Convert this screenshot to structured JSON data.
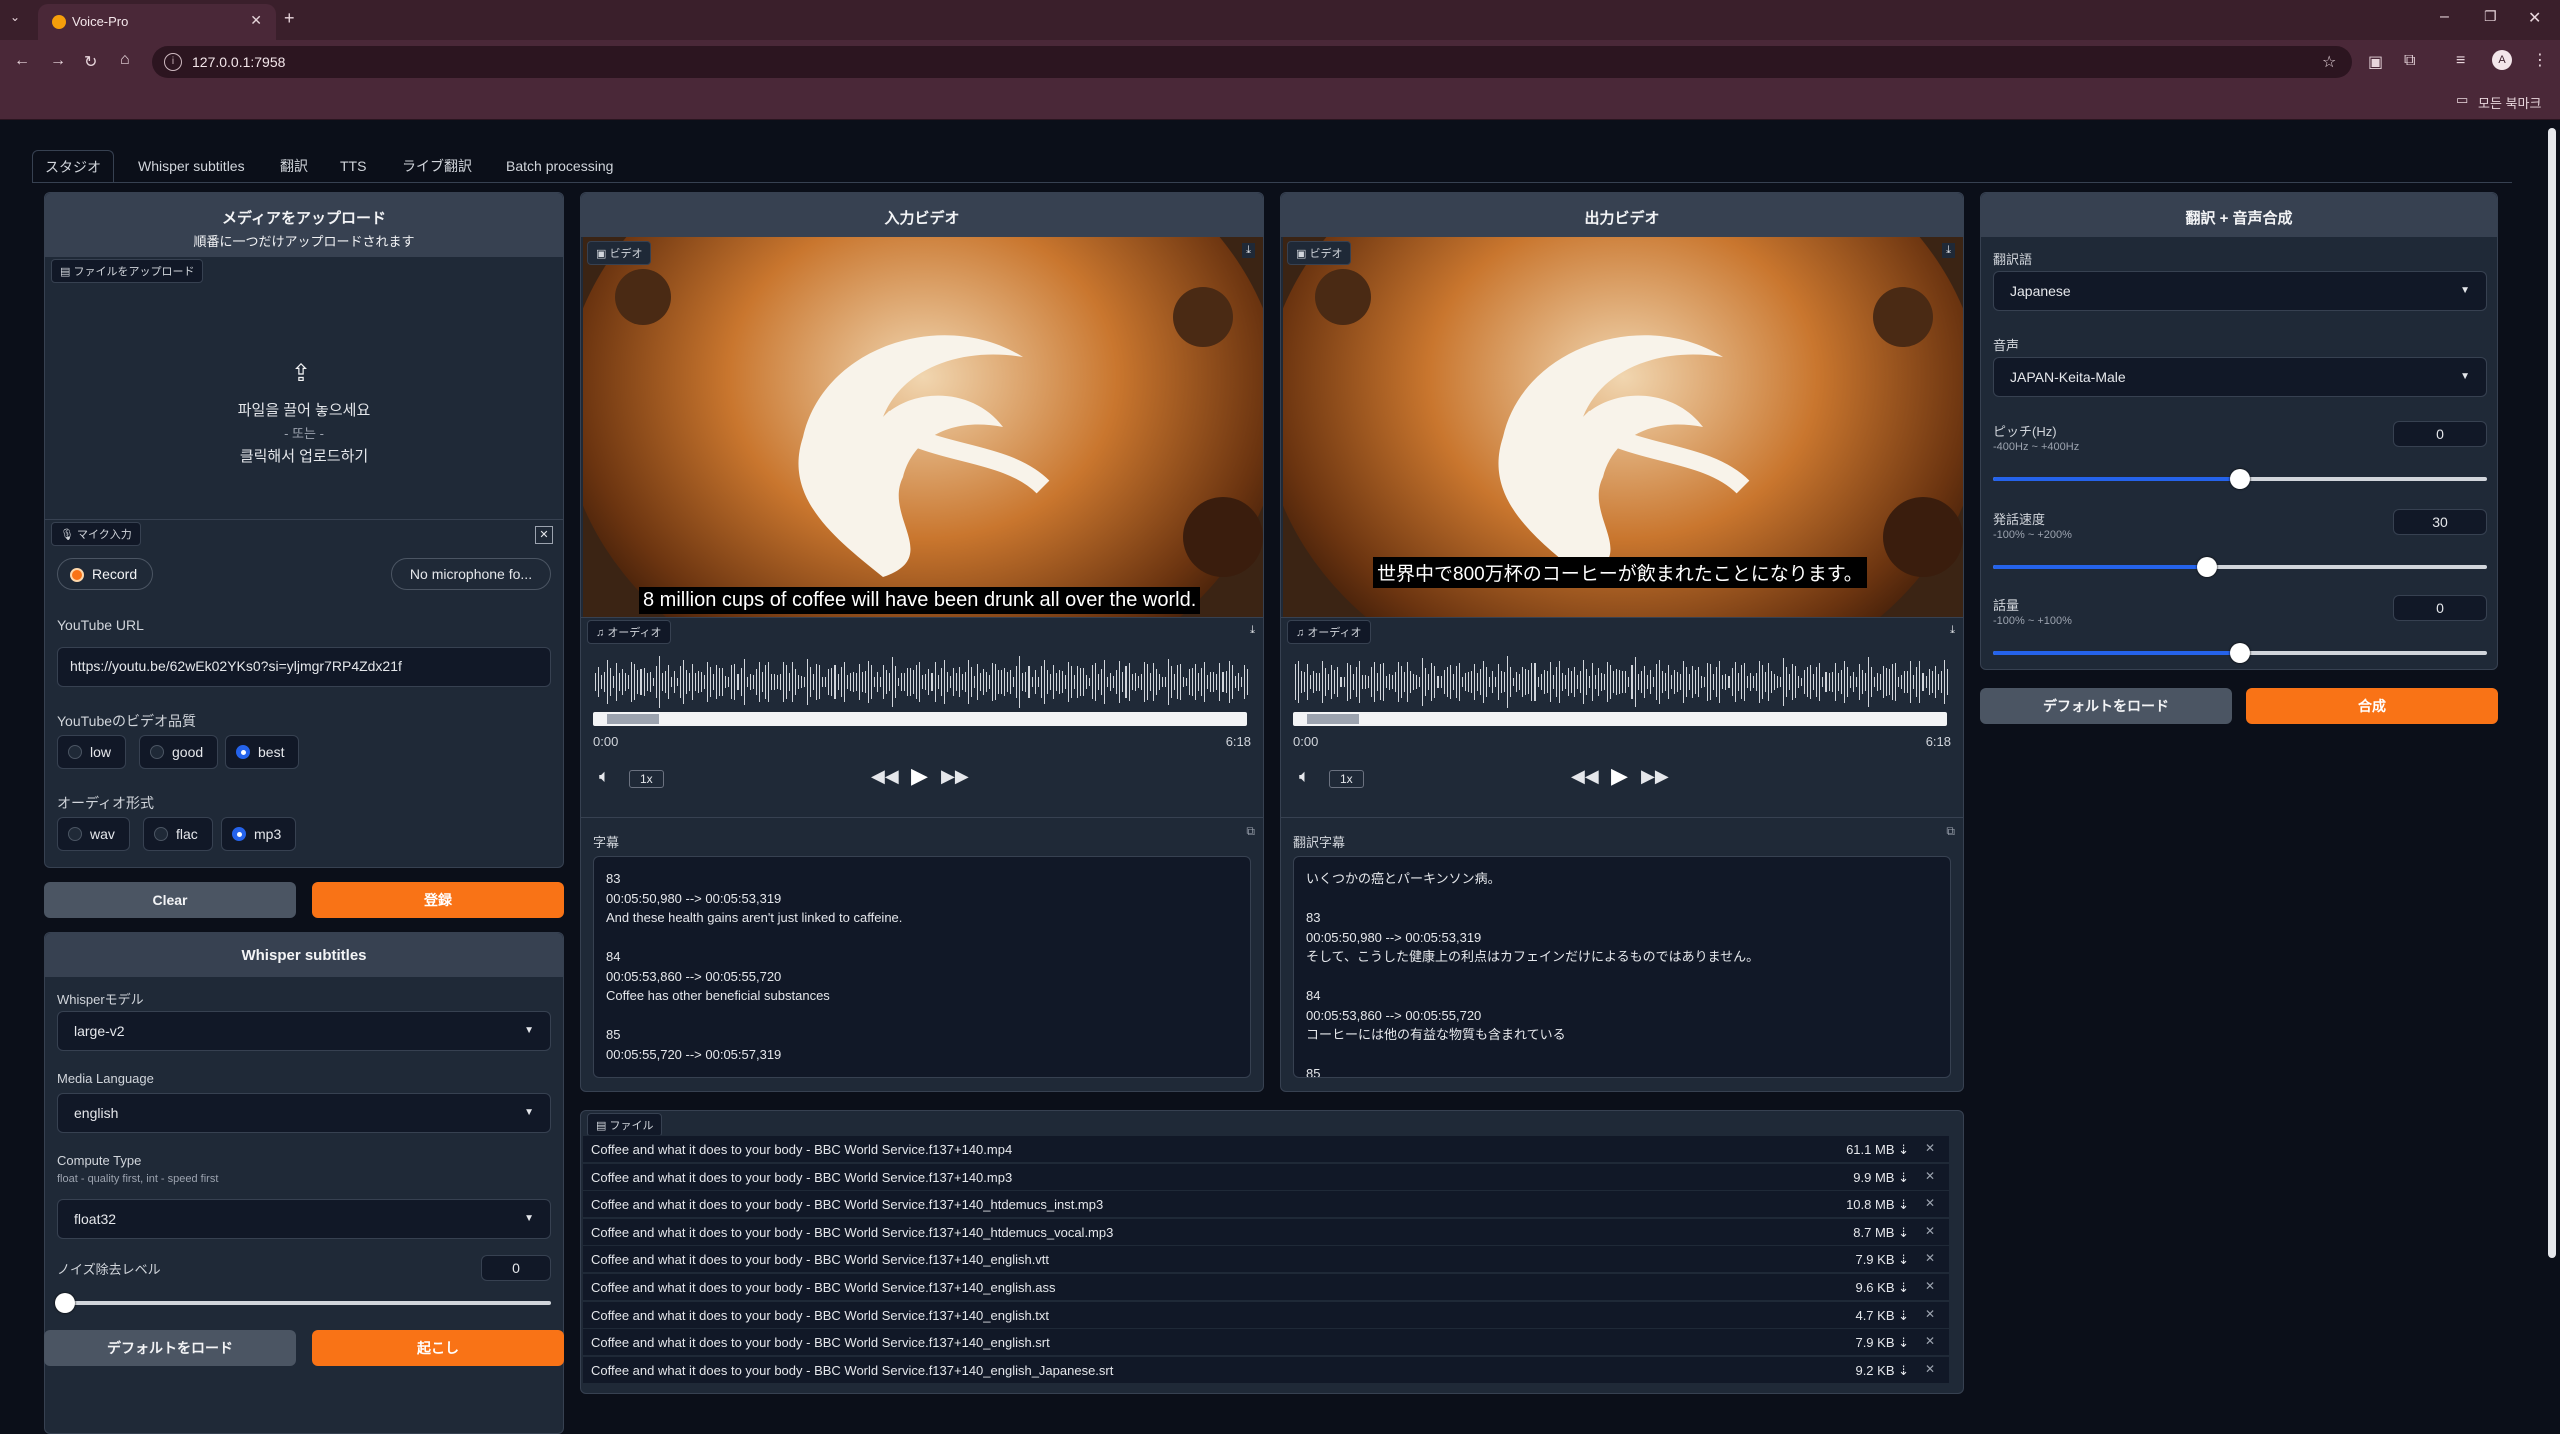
{
  "browser": {
    "tab_title": "Voice-Pro",
    "url": "127.0.0.1:7958",
    "bookmarks_label": "모든 북마크"
  },
  "app_tabs": [
    "スタジオ",
    "Whisper subtitles",
    "翻訳",
    "TTS",
    "ライブ翻訳",
    "Batch processing"
  ],
  "upload_panel": {
    "title": "メディアをアップロード",
    "subtitle": "順番に一つだけアップロードされます",
    "file_badge": "ファイルをアップロード",
    "drop_text": "파일을 끌어 놓으세요",
    "or_text": "- 또는 -",
    "click_text": "클릭해서 업로드하기",
    "mic_badge": "マイク入力",
    "record_label": "Record",
    "mic_device": "No microphone fo...",
    "youtube_label": "YouTube URL",
    "youtube_value": "https://youtu.be/62wEk02YKs0?si=yljmgr7RP4Zdx21f",
    "quality_label": "YouTubeのビデオ品質",
    "quality_options": [
      "low",
      "good",
      "best"
    ],
    "quality_selected": "best",
    "format_label": "オーディオ形式",
    "format_options": [
      "wav",
      "flac",
      "mp3"
    ],
    "format_selected": "mp3",
    "clear_btn": "Clear",
    "submit_btn": "登録"
  },
  "whisper_panel": {
    "title": "Whisper subtitles",
    "model_label": "Whisperモデル",
    "model_value": "large-v2",
    "lang_label": "Media Language",
    "lang_value": "english",
    "compute_label": "Compute Type",
    "compute_info": "float - quality first, int - speed first",
    "compute_value": "float32",
    "noise_label": "ノイズ除去レベル",
    "noise_value": "0",
    "noise_fraction": 0,
    "default_btn": "デフォルトをロード",
    "run_btn": "起こし"
  },
  "input_video": {
    "title": "入力ビデオ",
    "video_badge": "ビデオ",
    "subtitle": "8 million cups of coffee will have been drunk all over the world.",
    "audio_badge": "オーディオ",
    "time_start": "0:00",
    "time_end": "6:18",
    "speed": "1x",
    "subs_label": "字幕",
    "subs_text": "83\n00:05:50,980 --> 00:05:53,319\nAnd these health gains aren't just linked to caffeine.\n\n84\n00:05:53,860 --> 00:05:55,720\nCoffee has other beneficial substances\n\n85\n00:05:55,720 --> 00:05:57,319"
  },
  "output_video": {
    "title": "出力ビデオ",
    "video_badge": "ビデオ",
    "subtitle": "世界中で800万杯のコーヒーが飲まれたことになります。",
    "audio_badge": "オーディオ",
    "time_start": "0:00",
    "time_end": "6:18",
    "speed": "1x",
    "subs_label": "翻訳字幕",
    "subs_text": "いくつかの癌とパーキンソン病。\n\n83\n00:05:50,980 --> 00:05:53,319\nそして、こうした健康上の利点はカフェインだけによるものではありません。\n\n84\n00:05:53,860 --> 00:05:55,720\nコーヒーには他の有益な物質も含まれている\n\n85"
  },
  "tts_panel": {
    "title": "翻訳 + 音声合成",
    "lang_label": "翻訳語",
    "lang_value": "Japanese",
    "voice_label": "音声",
    "voice_value": "JAPAN-Keita-Male",
    "pitch_label": "ピッチ(Hz)",
    "pitch_range": "-400Hz ~ +400Hz",
    "pitch_value": "0",
    "pitch_fraction": 0.5,
    "rate_label": "発話速度",
    "rate_range": "-100% ~ +200%",
    "rate_value": "30",
    "rate_fraction": 0.4333,
    "volume_label": "話量",
    "volume_range": "-100% ~ +100%",
    "volume_value": "0",
    "volume_fraction": 0.5,
    "default_btn": "デフォルトをロード",
    "synth_btn": "合成"
  },
  "files_panel": {
    "badge": "ファイル",
    "files": [
      {
        "name": "Coffee and what it does to your body - BBC World Service.f137+140.mp4",
        "size": "61.1 MB ⇣"
      },
      {
        "name": "Coffee and what it does to your body - BBC World Service.f137+140.mp3",
        "size": "9.9 MB ⇣"
      },
      {
        "name": "Coffee and what it does to your body - BBC World Service.f137+140_htdemucs_inst.mp3",
        "size": "10.8 MB ⇣"
      },
      {
        "name": "Coffee and what it does to your body - BBC World Service.f137+140_htdemucs_vocal.mp3",
        "size": "8.7 MB ⇣"
      },
      {
        "name": "Coffee and what it does to your body - BBC World Service.f137+140_english.vtt",
        "size": "7.9 KB ⇣"
      },
      {
        "name": "Coffee and what it does to your body - BBC World Service.f137+140_english.ass",
        "size": "9.6 KB ⇣"
      },
      {
        "name": "Coffee and what it does to your body - BBC World Service.f137+140_english.txt",
        "size": "4.7 KB ⇣"
      },
      {
        "name": "Coffee and what it does to your body - BBC World Service.f137+140_english.srt",
        "size": "7.9 KB ⇣"
      },
      {
        "name": "Coffee and what it does to your body - BBC World Service.f137+140_english_Japanese.srt",
        "size": "9.2 KB ⇣"
      }
    ]
  }
}
